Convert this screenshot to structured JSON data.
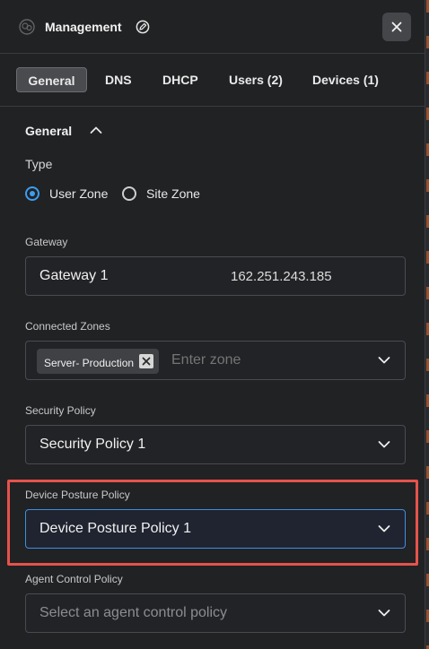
{
  "header": {
    "title": "Management"
  },
  "tabs": [
    {
      "label": "General",
      "active": true
    },
    {
      "label": "DNS",
      "active": false
    },
    {
      "label": "DHCP",
      "active": false
    },
    {
      "label": "Users (2)",
      "active": false
    },
    {
      "label": "Devices (1)",
      "active": false
    }
  ],
  "general": {
    "section_title": "General",
    "type_label": "Type",
    "type_options": [
      {
        "label": "User Zone",
        "checked": true
      },
      {
        "label": "Site Zone",
        "checked": false
      }
    ],
    "gateway": {
      "label": "Gateway",
      "value": "Gateway 1",
      "ip": "162.251.243.185"
    },
    "connected_zones": {
      "label": "Connected Zones",
      "chip": "Server- Production",
      "placeholder": "Enter zone"
    },
    "security_policy": {
      "label": "Security Policy",
      "value": "Security Policy 1"
    },
    "device_posture_policy": {
      "label": "Device Posture Policy",
      "value": "Device Posture Policy 1"
    },
    "agent_control_policy": {
      "label": "Agent Control Policy",
      "placeholder": "Select an agent control policy"
    }
  },
  "colors": {
    "accent": "#3d9df0",
    "highlight": "#e5534b",
    "background": "#212224"
  },
  "icons": {
    "logo": "zone-logo-icon",
    "edit": "edit-icon",
    "close": "close-icon",
    "collapse": "chevron-up-icon",
    "dropdown": "chevron-down-icon",
    "chip_remove": "remove-chip-icon"
  }
}
